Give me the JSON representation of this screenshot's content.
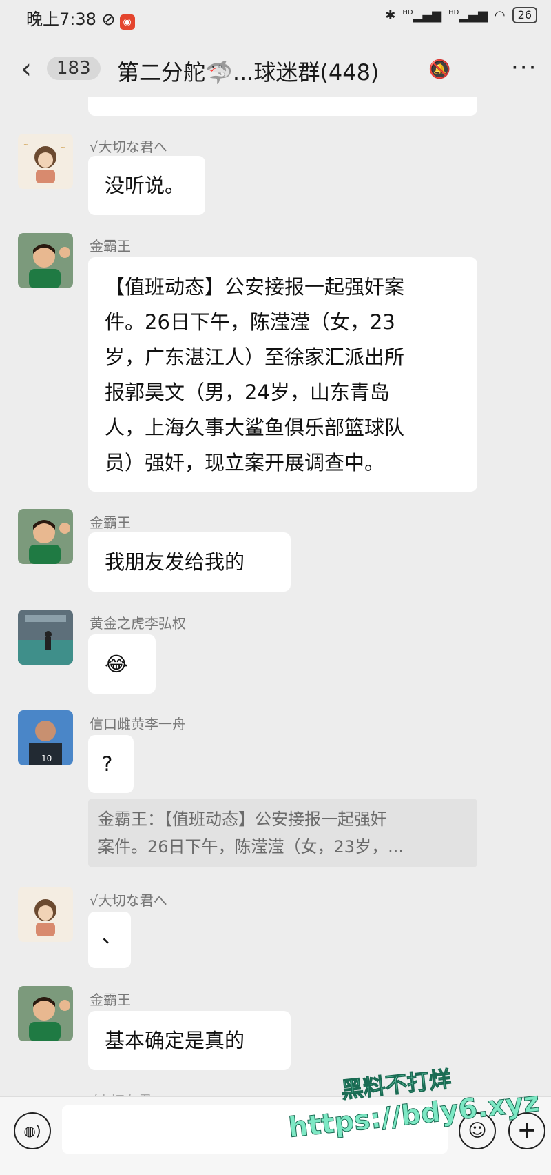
{
  "status_bar": {
    "time": "晚上7:38",
    "signal1": "HD",
    "signal2": "HD",
    "battery": "26"
  },
  "header": {
    "back_count": "183",
    "title": "第二分舵🦈...球迷群(448)",
    "more": "···"
  },
  "messages": [
    {
      "sender": "√大切な君へ",
      "text": "没听说。"
    },
    {
      "sender": "金霸王",
      "lines": [
        "【值班动态】公安接报一起强奸案",
        "件。26日下午，陈滢滢（女，23",
        "岁，广东湛江人）至徐家汇派出所",
        "报郭昊文（男，24岁，山东青岛",
        "人，上海久事大鲨鱼俱乐部篮球队",
        "员）强奸，现立案开展调查中。"
      ]
    },
    {
      "sender": "金霸王",
      "text": "我朋友发给我的"
    },
    {
      "sender": "黄金之虎李弘权",
      "text": "😂"
    },
    {
      "sender": "信口雌黄李一舟",
      "text": "?"
    },
    {
      "sender": "√大切な君へ",
      "text": "、"
    },
    {
      "sender": "金霸王",
      "text": "基本确定是真的"
    }
  ],
  "quote": {
    "line1": "金霸王：【值班动态】公安接报一起强奸",
    "line2": "案件。26日下午，陈滢滢（女，23岁，..."
  },
  "partial_sender": "√大切な君へ",
  "watermark": {
    "line1": "黑料不打烊",
    "line2": "https://bdy6.xyz"
  },
  "bottom_bar": {
    "voice_icon": "voice-icon",
    "emoji_icon": "smile-icon",
    "plus_icon": "plus-icon"
  }
}
